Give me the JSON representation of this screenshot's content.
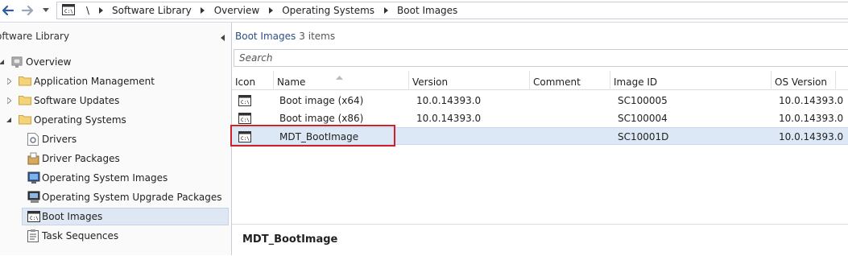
{
  "breadcrumb": {
    "root": "\\",
    "items": [
      "Software Library",
      "Overview",
      "Operating Systems",
      "Boot Images"
    ]
  },
  "left_panel": {
    "title": "oftware Library",
    "tree": [
      {
        "label": "Overview",
        "icon": "overview-icon"
      },
      {
        "label": "Application Management",
        "icon": "folder-icon"
      },
      {
        "label": "Software Updates",
        "icon": "folder-icon"
      },
      {
        "label": "Operating Systems",
        "icon": "folder-open-icon"
      },
      {
        "label": "Drivers",
        "icon": "driver-icon"
      },
      {
        "label": "Driver Packages",
        "icon": "driver-package-icon"
      },
      {
        "label": "Operating System Images",
        "icon": "os-image-icon"
      },
      {
        "label": "Operating System Upgrade Packages",
        "icon": "os-upgrade-icon"
      },
      {
        "label": "Boot Images",
        "icon": "boot-image-icon"
      },
      {
        "label": "Task Sequences",
        "icon": "task-sequence-icon"
      }
    ]
  },
  "main": {
    "title": "Boot Images",
    "count": "3 items",
    "search_placeholder": "Search",
    "columns": [
      "Icon",
      "Name",
      "Version",
      "Comment",
      "Image ID",
      "OS Version"
    ],
    "rows": [
      {
        "name": "Boot image (x64)",
        "version": "10.0.14393.0",
        "comment": "",
        "image_id": "SC100005",
        "os_version": "10.0.14393.0"
      },
      {
        "name": "Boot image (x86)",
        "version": "10.0.14393.0",
        "comment": "",
        "image_id": "SC100004",
        "os_version": "10.0.14393.0"
      },
      {
        "name": "MDT_BootImage",
        "version": "",
        "comment": "",
        "image_id": "SC10001D",
        "os_version": "10.0.14393.0"
      }
    ],
    "selected_row": 2,
    "detail_title": "MDT_BootImage"
  },
  "colors": {
    "highlight": "#d0202a",
    "selection": "#dde8f6",
    "header_text": "#2b4f84"
  }
}
